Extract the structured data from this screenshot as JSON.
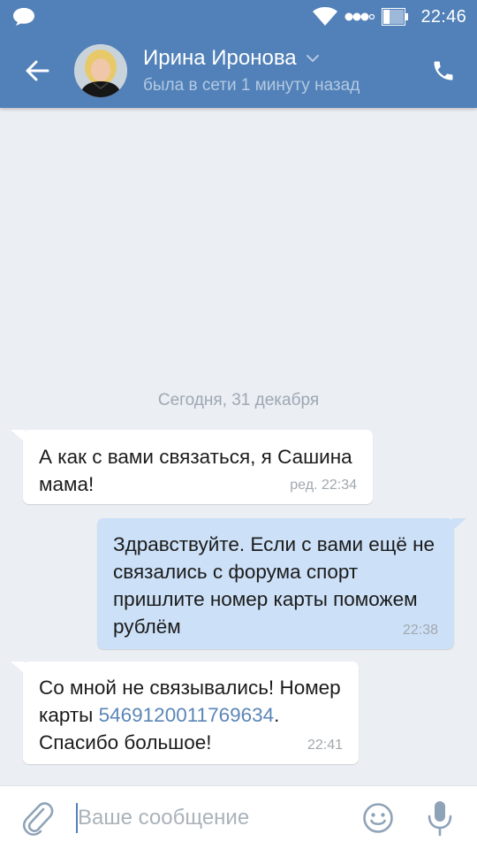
{
  "status_bar": {
    "time": "22:46",
    "icons": [
      "message-icon",
      "wifi-icon",
      "signal-dots-icon",
      "battery-icon"
    ]
  },
  "header": {
    "contact_name": "Ирина Иронова",
    "contact_status": "была в сети 1 минуту назад",
    "icons": [
      "back-arrow-icon",
      "chevron-down-icon",
      "phone-icon"
    ]
  },
  "chat": {
    "date_separator": "Сегодня, 31 декабря",
    "messages": [
      {
        "direction": "incoming",
        "text": "А как с вами связаться, я Сашина мама!",
        "meta": "ред. 22:34"
      },
      {
        "direction": "outgoing",
        "text": "Здравствуйте. Если с вами ещё не связались с форума спорт пришлите номер карты поможем рублём",
        "meta": "22:38"
      },
      {
        "direction": "incoming",
        "text_before": "Со мной не связывались! Номер карты ",
        "link": "5469120011769634",
        "text_after": ". Спасибо большое!",
        "meta": "22:41"
      }
    ]
  },
  "composer": {
    "placeholder": "Ваше сообщение",
    "value": "",
    "icons": [
      "paperclip-icon",
      "emoji-icon",
      "microphone-icon"
    ]
  },
  "colors": {
    "header": "#5181b8",
    "background": "#ebeef2",
    "incoming_bubble": "#ffffff",
    "outgoing_bubble": "#cce0f7",
    "link": "#5b86b8"
  }
}
